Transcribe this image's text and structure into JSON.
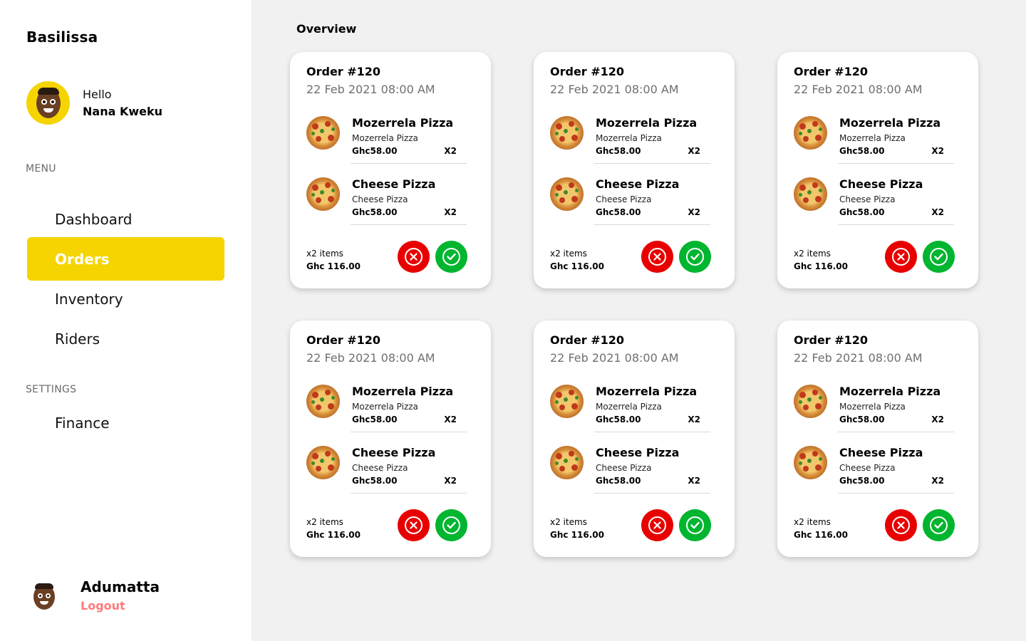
{
  "brand": "Basilissa",
  "user": {
    "greeting": "Hello",
    "name": "Nana Kweku"
  },
  "menu_label": "MENU",
  "nav": [
    {
      "label": "Dashboard",
      "active": false
    },
    {
      "label": "Orders",
      "active": true
    },
    {
      "label": "Inventory",
      "active": false
    },
    {
      "label": "Riders",
      "active": false
    }
  ],
  "settings_label": "SETTINGS",
  "settings_nav": [
    {
      "label": "Finance"
    }
  ],
  "account": {
    "name": "Adumatta",
    "logout_label": "Logout"
  },
  "page_title": "Overview",
  "colors": {
    "accent": "#f5d400",
    "reject": "#e80000",
    "accept": "#00b52f",
    "logout": "#ff7a7a",
    "background": "#f1f1f1"
  },
  "orders": [
    {
      "order_no": "Order #120",
      "date": "22 Feb 2021 08:00 AM",
      "items": [
        {
          "name": "Mozerrela Pizza",
          "sub": "Mozerrela Pizza",
          "price": "Ghc58.00",
          "qty": "X2",
          "icon": "pizza-icon"
        },
        {
          "name": "Cheese Pizza",
          "sub": "Cheese Pizza",
          "price": "Ghc58.00",
          "qty": "X2",
          "icon": "pizza-icon"
        }
      ],
      "items_count": "x2 items",
      "total": "Ghc 116.00"
    },
    {
      "order_no": "Order #120",
      "date": "22 Feb 2021 08:00 AM",
      "items": [
        {
          "name": "Mozerrela Pizza",
          "sub": "Mozerrela Pizza",
          "price": "Ghc58.00",
          "qty": "X2",
          "icon": "pizza-icon"
        },
        {
          "name": "Cheese Pizza",
          "sub": "Cheese Pizza",
          "price": "Ghc58.00",
          "qty": "X2",
          "icon": "pizza-icon"
        }
      ],
      "items_count": "x2 items",
      "total": "Ghc 116.00"
    },
    {
      "order_no": "Order #120",
      "date": "22 Feb 2021 08:00 AM",
      "items": [
        {
          "name": "Mozerrela Pizza",
          "sub": "Mozerrela Pizza",
          "price": "Ghc58.00",
          "qty": "X2",
          "icon": "pizza-icon"
        },
        {
          "name": "Cheese Pizza",
          "sub": "Cheese Pizza",
          "price": "Ghc58.00",
          "qty": "X2",
          "icon": "pizza-icon"
        }
      ],
      "items_count": "x2 items",
      "total": "Ghc 116.00"
    },
    {
      "order_no": "Order #120",
      "date": "22 Feb 2021 08:00 AM",
      "items": [
        {
          "name": "Mozerrela Pizza",
          "sub": "Mozerrela Pizza",
          "price": "Ghc58.00",
          "qty": "X2",
          "icon": "pizza-icon"
        },
        {
          "name": "Cheese Pizza",
          "sub": "Cheese Pizza",
          "price": "Ghc58.00",
          "qty": "X2",
          "icon": "pizza-icon"
        }
      ],
      "items_count": "x2 items",
      "total": "Ghc 116.00"
    },
    {
      "order_no": "Order #120",
      "date": "22 Feb 2021 08:00 AM",
      "items": [
        {
          "name": "Mozerrela Pizza",
          "sub": "Mozerrela Pizza",
          "price": "Ghc58.00",
          "qty": "X2",
          "icon": "pizza-icon"
        },
        {
          "name": "Cheese Pizza",
          "sub": "Cheese Pizza",
          "price": "Ghc58.00",
          "qty": "X2",
          "icon": "pizza-icon"
        }
      ],
      "items_count": "x2 items",
      "total": "Ghc 116.00"
    },
    {
      "order_no": "Order #120",
      "date": "22 Feb 2021 08:00 AM",
      "items": [
        {
          "name": "Mozerrela Pizza",
          "sub": "Mozerrela Pizza",
          "price": "Ghc58.00",
          "qty": "X2",
          "icon": "pizza-icon"
        },
        {
          "name": "Cheese Pizza",
          "sub": "Cheese Pizza",
          "price": "Ghc58.00",
          "qty": "X2",
          "icon": "pizza-icon"
        }
      ],
      "items_count": "x2 items",
      "total": "Ghc 116.00"
    }
  ]
}
